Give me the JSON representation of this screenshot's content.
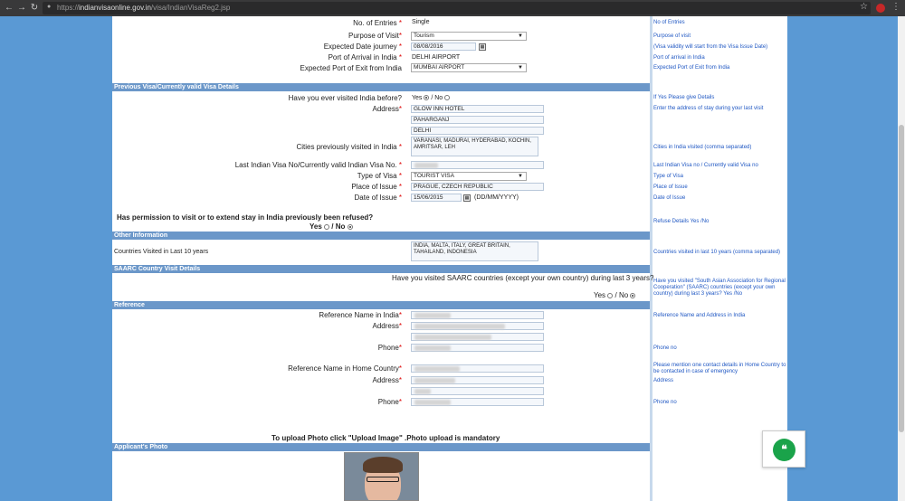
{
  "browser": {
    "url_scheme": "https://",
    "url_host": "indianvisaonline.gov.in",
    "url_path": "/visa/IndianVisaReg2.jsp"
  },
  "top": {
    "entries_label": "No. of Entries",
    "entries_value": "Single",
    "entries_help": "No of Entries",
    "purpose_label": "Purpose of Visit",
    "purpose_value": "Tourism",
    "purpose_help": "Purpose of visit",
    "journey_label": "Expected Date journey",
    "journey_value": "08/08/2016",
    "journey_help": "(Visa validity will start from the Visa Issue Date)",
    "arrival_label": "Port of Arrival in India",
    "arrival_value": "DELHI AIRPORT",
    "arrival_help": "Port of arrival in India",
    "exit_label": "Expected Port of Exit from India",
    "exit_value": "MUMBAI AIRPORT",
    "exit_help": "Expected Port of Exit from India"
  },
  "previous_visa": {
    "section_title": "Previous Visa/Currently valid Visa Details",
    "visited_label": "Have you ever visited India before?",
    "yes": "Yes",
    "no": "No",
    "visited_help": "If Yes Please give Details",
    "address_label": "Address",
    "address_line1": "GLOW INN HOTEL",
    "address_line2": "PAHARGANJ",
    "address_line3": "DELHI",
    "address_help": "Enter the address of stay during your last visit",
    "cities_label": "Cities previously visited in India",
    "cities_value": "VARANASI, MADURAI, HYDERABAD, KOCHIN, AMRITSAR, LEH",
    "cities_help": "Cities in India visited (comma separated)",
    "visano_label": "Last Indian Visa No/Currently valid Indian Visa No.",
    "visano_help": "Last Indian Visa no / Currently valid Visa no",
    "type_label": "Type of Visa",
    "type_value": "TOURIST VISA",
    "type_help": "Type of Visa",
    "place_label": "Place of Issue",
    "place_value": "PRAGUE, CZECH REPUBLIC",
    "place_help": "Place of Issue",
    "date_label": "Date of Issue",
    "date_value": "15/06/2015",
    "date_format": "(DD/MM/YYYY)",
    "date_help": "Date of Issue",
    "refused_question": "Has permission to visit or to extend stay in India previously been refused?",
    "refused_help": "Refuse Details Yes /No"
  },
  "other": {
    "section_title": "Other Information",
    "countries_label": "Countries Visited in Last 10 years",
    "countries_value": "INDIA, MALTA, ITALY, GREAT BRITAIN, TAHAILAND, INDONESIA",
    "countries_help": "Countries visited in last 10 years (comma separated)"
  },
  "saarc": {
    "section_title": "SAARC Country Visit Details",
    "question": "Have you visited SAARC countries (except your own country) during last 3 years?",
    "help": "Have you visited \"South Asian Association for Regional Cooperation\" (SAARC) countries (except your own country) during last 3 years? Yes /No"
  },
  "reference": {
    "section_title": "Reference",
    "india_name_label": "Reference Name in India",
    "india_help": "Reference Name and Address in India",
    "address_label": "Address",
    "phone_label": "Phone",
    "phone_help": "Phone no",
    "home_name_label": "Reference Name in Home Country",
    "home_help": "Please mention one contact details in Home Country to be contacted in case of emergency",
    "address_help": "Address"
  },
  "photo": {
    "upload_note": "To upload Photo click \"Upload Image\" .Photo upload is mandatory",
    "section_title": "Applicant's Photo"
  },
  "icons": {
    "chat": "chat-quote-icon",
    "star": "bookmark-star-icon",
    "menu": "kebab-menu-icon"
  }
}
